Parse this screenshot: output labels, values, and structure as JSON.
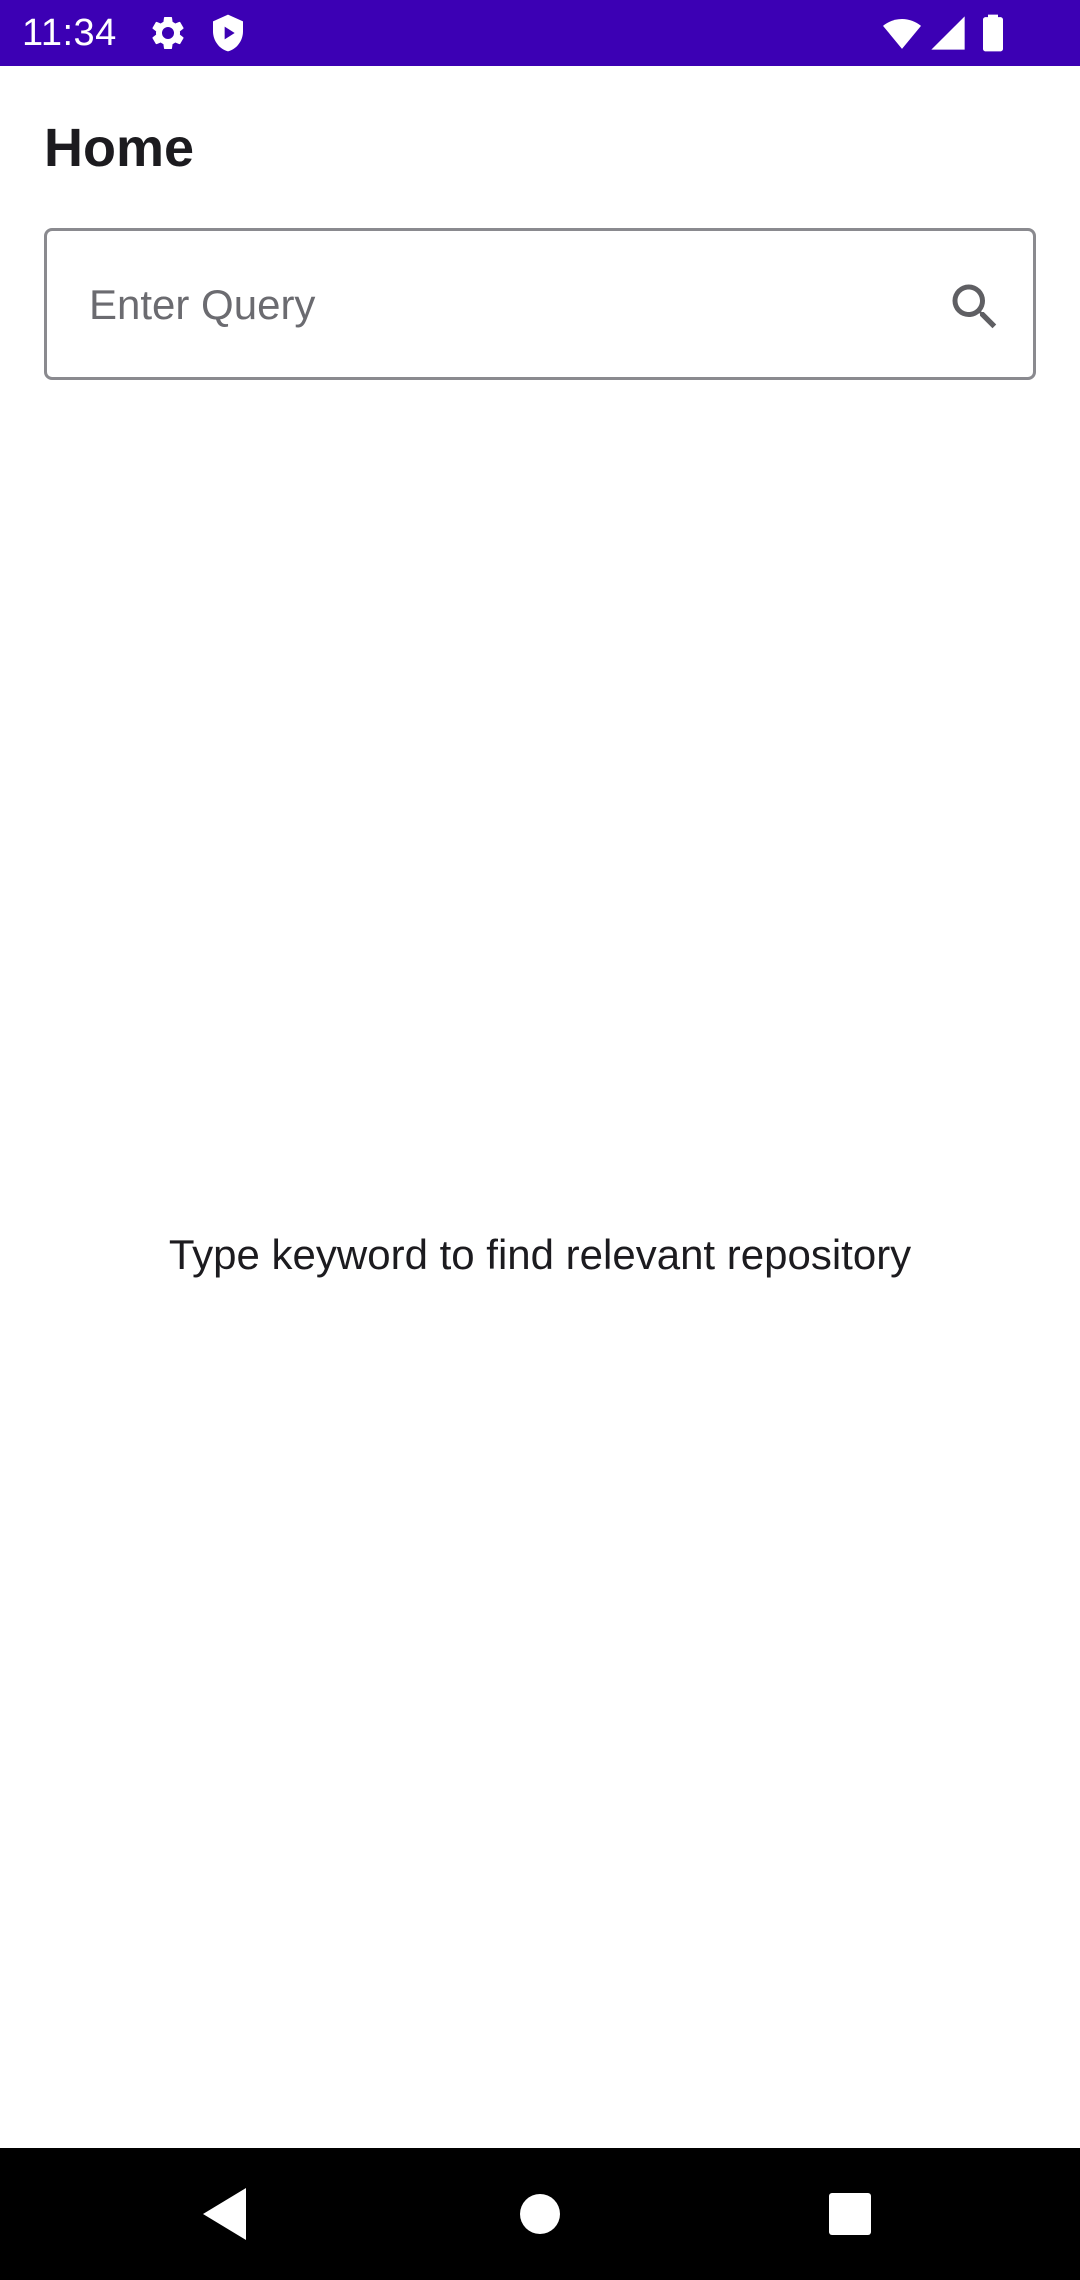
{
  "status_bar": {
    "time": "11:34",
    "background_color": "#3c00b4",
    "left_icons": [
      "gear-icon",
      "shield-icon"
    ],
    "right_icons": [
      "wifi-icon",
      "signal-icon",
      "battery-icon"
    ]
  },
  "header": {
    "title": "Home"
  },
  "search": {
    "placeholder": "Enter Query",
    "value": "",
    "icon": "search-icon"
  },
  "main": {
    "empty_message": "Type keyword to find relevant repository"
  },
  "nav_bar": {
    "buttons": [
      "back-icon",
      "home-icon",
      "recents-icon"
    ]
  }
}
